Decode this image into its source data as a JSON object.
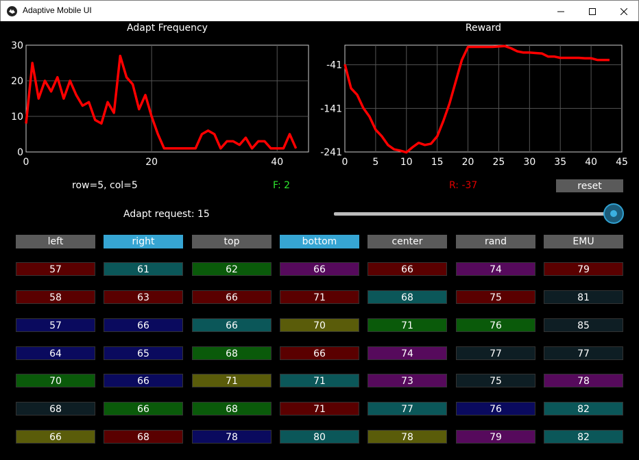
{
  "window": {
    "title": "Adaptive Mobile UI"
  },
  "charts": {
    "freq_title": "Adapt Frequency",
    "reward_title": "Reward"
  },
  "chart_data": [
    {
      "type": "line",
      "title": "Adapt Frequency",
      "xlim": [
        0,
        45
      ],
      "ylim": [
        0,
        30
      ],
      "xticks": [
        0,
        20,
        40
      ],
      "yticks": [
        0,
        10,
        20,
        30
      ],
      "grid": true,
      "color": "#ff0000",
      "x": [
        0,
        1,
        2,
        3,
        4,
        5,
        6,
        7,
        8,
        9,
        10,
        11,
        12,
        13,
        14,
        15,
        16,
        17,
        18,
        19,
        20,
        21,
        22,
        23,
        24,
        25,
        26,
        27,
        28,
        29,
        30,
        31,
        32,
        33,
        34,
        35,
        36,
        37,
        38,
        39,
        40,
        41,
        42,
        43
      ],
      "y": [
        8,
        25,
        15,
        20,
        17,
        21,
        15,
        20,
        16,
        13,
        14,
        9,
        8,
        14,
        11,
        27,
        21,
        19,
        12,
        16,
        10,
        5,
        1,
        1,
        1,
        1,
        1,
        1,
        5,
        6,
        5,
        1,
        3,
        3,
        2,
        4,
        1,
        3,
        3,
        1,
        1,
        1,
        5,
        1
      ]
    },
    {
      "type": "line",
      "title": "Reward",
      "xlim": [
        0,
        45
      ],
      "ylim": [
        -241,
        4
      ],
      "xticks": [
        0,
        5,
        10,
        15,
        20,
        25,
        30,
        35,
        40,
        45
      ],
      "yticks": [
        -241,
        -141,
        -41
      ],
      "grid": true,
      "color": "#ff0000",
      "x": [
        0,
        1,
        2,
        3,
        4,
        5,
        6,
        7,
        8,
        9,
        10,
        11,
        12,
        13,
        14,
        15,
        16,
        17,
        18,
        19,
        20,
        21,
        22,
        23,
        24,
        25,
        26,
        27,
        28,
        29,
        30,
        31,
        32,
        33,
        34,
        35,
        36,
        37,
        38,
        39,
        40,
        41,
        42,
        43
      ],
      "y": [
        -40,
        -95,
        -110,
        -140,
        -160,
        -190,
        -205,
        -225,
        -235,
        -238,
        -242,
        -230,
        -220,
        -225,
        -222,
        -205,
        -170,
        -130,
        -80,
        -30,
        0,
        0,
        0,
        0,
        0,
        1,
        2,
        -3,
        -10,
        -13,
        -13,
        -14,
        -15,
        -22,
        -22,
        -25,
        -25,
        -25,
        -25,
        -26,
        -26,
        -30,
        -30,
        -30
      ]
    }
  ],
  "status": {
    "position": "row=5, col=5",
    "freq": "F: 2",
    "reward": "R: -37",
    "reset_label": "reset",
    "adapt_request": "Adapt request: 15"
  },
  "slider": {
    "value": 1.0
  },
  "colors": {
    "button_gray": "#5a5a5a",
    "button_active": "#36a5d3",
    "cell_red": "#5a0000",
    "cell_teal": "#0b5759",
    "cell_green": "#0a5a0a",
    "cell_purple": "#560a5c",
    "cell_navy": "#0a0a5e",
    "cell_olive": "#5a5c0a",
    "cell_dark": "#0e1e24"
  },
  "options": [
    {
      "label": "left",
      "active": false
    },
    {
      "label": "right",
      "active": true
    },
    {
      "label": "top",
      "active": false
    },
    {
      "label": "bottom",
      "active": true
    },
    {
      "label": "center",
      "active": false
    },
    {
      "label": "rand",
      "active": false
    },
    {
      "label": "EMU",
      "active": false
    }
  ],
  "grid": [
    [
      {
        "v": "57",
        "c": "cell_red"
      },
      {
        "v": "61",
        "c": "cell_teal"
      },
      {
        "v": "62",
        "c": "cell_green"
      },
      {
        "v": "66",
        "c": "cell_purple"
      },
      {
        "v": "66",
        "c": "cell_red"
      },
      {
        "v": "74",
        "c": "cell_purple"
      },
      {
        "v": "79",
        "c": "cell_red"
      }
    ],
    [
      {
        "v": "58",
        "c": "cell_red"
      },
      {
        "v": "63",
        "c": "cell_red"
      },
      {
        "v": "66",
        "c": "cell_red"
      },
      {
        "v": "71",
        "c": "cell_red"
      },
      {
        "v": "68",
        "c": "cell_teal"
      },
      {
        "v": "75",
        "c": "cell_red"
      },
      {
        "v": "81",
        "c": "cell_dark"
      }
    ],
    [
      {
        "v": "57",
        "c": "cell_navy"
      },
      {
        "v": "66",
        "c": "cell_navy"
      },
      {
        "v": "66",
        "c": "cell_teal"
      },
      {
        "v": "70",
        "c": "cell_olive"
      },
      {
        "v": "71",
        "c": "cell_green"
      },
      {
        "v": "76",
        "c": "cell_green"
      },
      {
        "v": "85",
        "c": "cell_dark"
      }
    ],
    [
      {
        "v": "64",
        "c": "cell_navy"
      },
      {
        "v": "65",
        "c": "cell_navy"
      },
      {
        "v": "68",
        "c": "cell_green"
      },
      {
        "v": "66",
        "c": "cell_red"
      },
      {
        "v": "74",
        "c": "cell_purple"
      },
      {
        "v": "77",
        "c": "cell_dark"
      },
      {
        "v": "77",
        "c": "cell_dark"
      }
    ],
    [
      {
        "v": "70",
        "c": "cell_green"
      },
      {
        "v": "66",
        "c": "cell_navy"
      },
      {
        "v": "71",
        "c": "cell_olive"
      },
      {
        "v": "71",
        "c": "cell_teal"
      },
      {
        "v": "73",
        "c": "cell_purple"
      },
      {
        "v": "75",
        "c": "cell_dark"
      },
      {
        "v": "78",
        "c": "cell_purple"
      }
    ],
    [
      {
        "v": "68",
        "c": "cell_dark"
      },
      {
        "v": "66",
        "c": "cell_green"
      },
      {
        "v": "68",
        "c": "cell_green"
      },
      {
        "v": "71",
        "c": "cell_red"
      },
      {
        "v": "77",
        "c": "cell_teal"
      },
      {
        "v": "76",
        "c": "cell_navy"
      },
      {
        "v": "82",
        "c": "cell_teal"
      }
    ],
    [
      {
        "v": "66",
        "c": "cell_olive"
      },
      {
        "v": "68",
        "c": "cell_red"
      },
      {
        "v": "78",
        "c": "cell_navy"
      },
      {
        "v": "80",
        "c": "cell_teal"
      },
      {
        "v": "78",
        "c": "cell_olive"
      },
      {
        "v": "79",
        "c": "cell_purple"
      },
      {
        "v": "82",
        "c": "cell_teal"
      }
    ]
  ]
}
